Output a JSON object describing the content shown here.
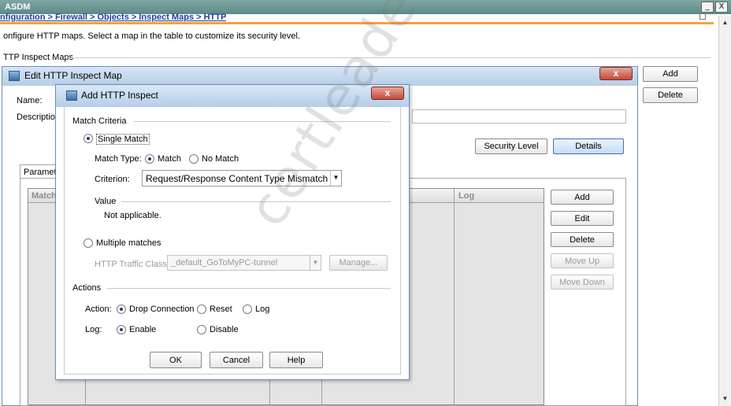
{
  "window": {
    "title": "ASDM",
    "breadcrumb": "nfiguration > Firewall > Objects > Inspect Maps > HTTP",
    "intro": "onfigure HTTP maps. Select a map in the table to customize its security level.",
    "maps_label": "TTP Inspect Maps",
    "buttons": {
      "add": "Add",
      "delete": "Delete"
    },
    "min_icon": "_",
    "close_icon": "X"
  },
  "edit_map": {
    "title": "Edit HTTP Inspect Map",
    "close": "x",
    "name_label": "Name:",
    "description_label": "Description:",
    "security_level_btn": "Security Level",
    "details_btn": "Details",
    "tab": "Parameter",
    "grid_headers": {
      "match": "Match",
      "log": "Log"
    },
    "side_buttons": {
      "add": "Add",
      "edit": "Edit",
      "delete": "Delete",
      "move_up": "Move Up",
      "move_down": "Move Down"
    }
  },
  "dialog": {
    "title": "Add HTTP Inspect",
    "close": "x",
    "match_criteria": "Match Criteria",
    "single_match": "Single Match",
    "match_type_label": "Match Type:",
    "match": "Match",
    "no_match": "No Match",
    "criterion_label": "Criterion:",
    "criterion_value": "Request/Response Content Type Mismatch",
    "value_label": "Value",
    "value_text": "Not applicable.",
    "multiple_matches": "Multiple matches",
    "traffic_class_label": "HTTP Traffic Class:",
    "traffic_class_value": "_default_GoToMyPC-tunnel",
    "manage": "Manage...",
    "actions": "Actions",
    "action_label": "Action:",
    "drop_connection": "Drop Connection",
    "reset": "Reset",
    "log": "Log",
    "log_label": "Log:",
    "enable": "Enable",
    "disable": "Disable",
    "ok": "OK",
    "cancel": "Cancel",
    "help": "Help"
  },
  "watermark": "certleader.com"
}
